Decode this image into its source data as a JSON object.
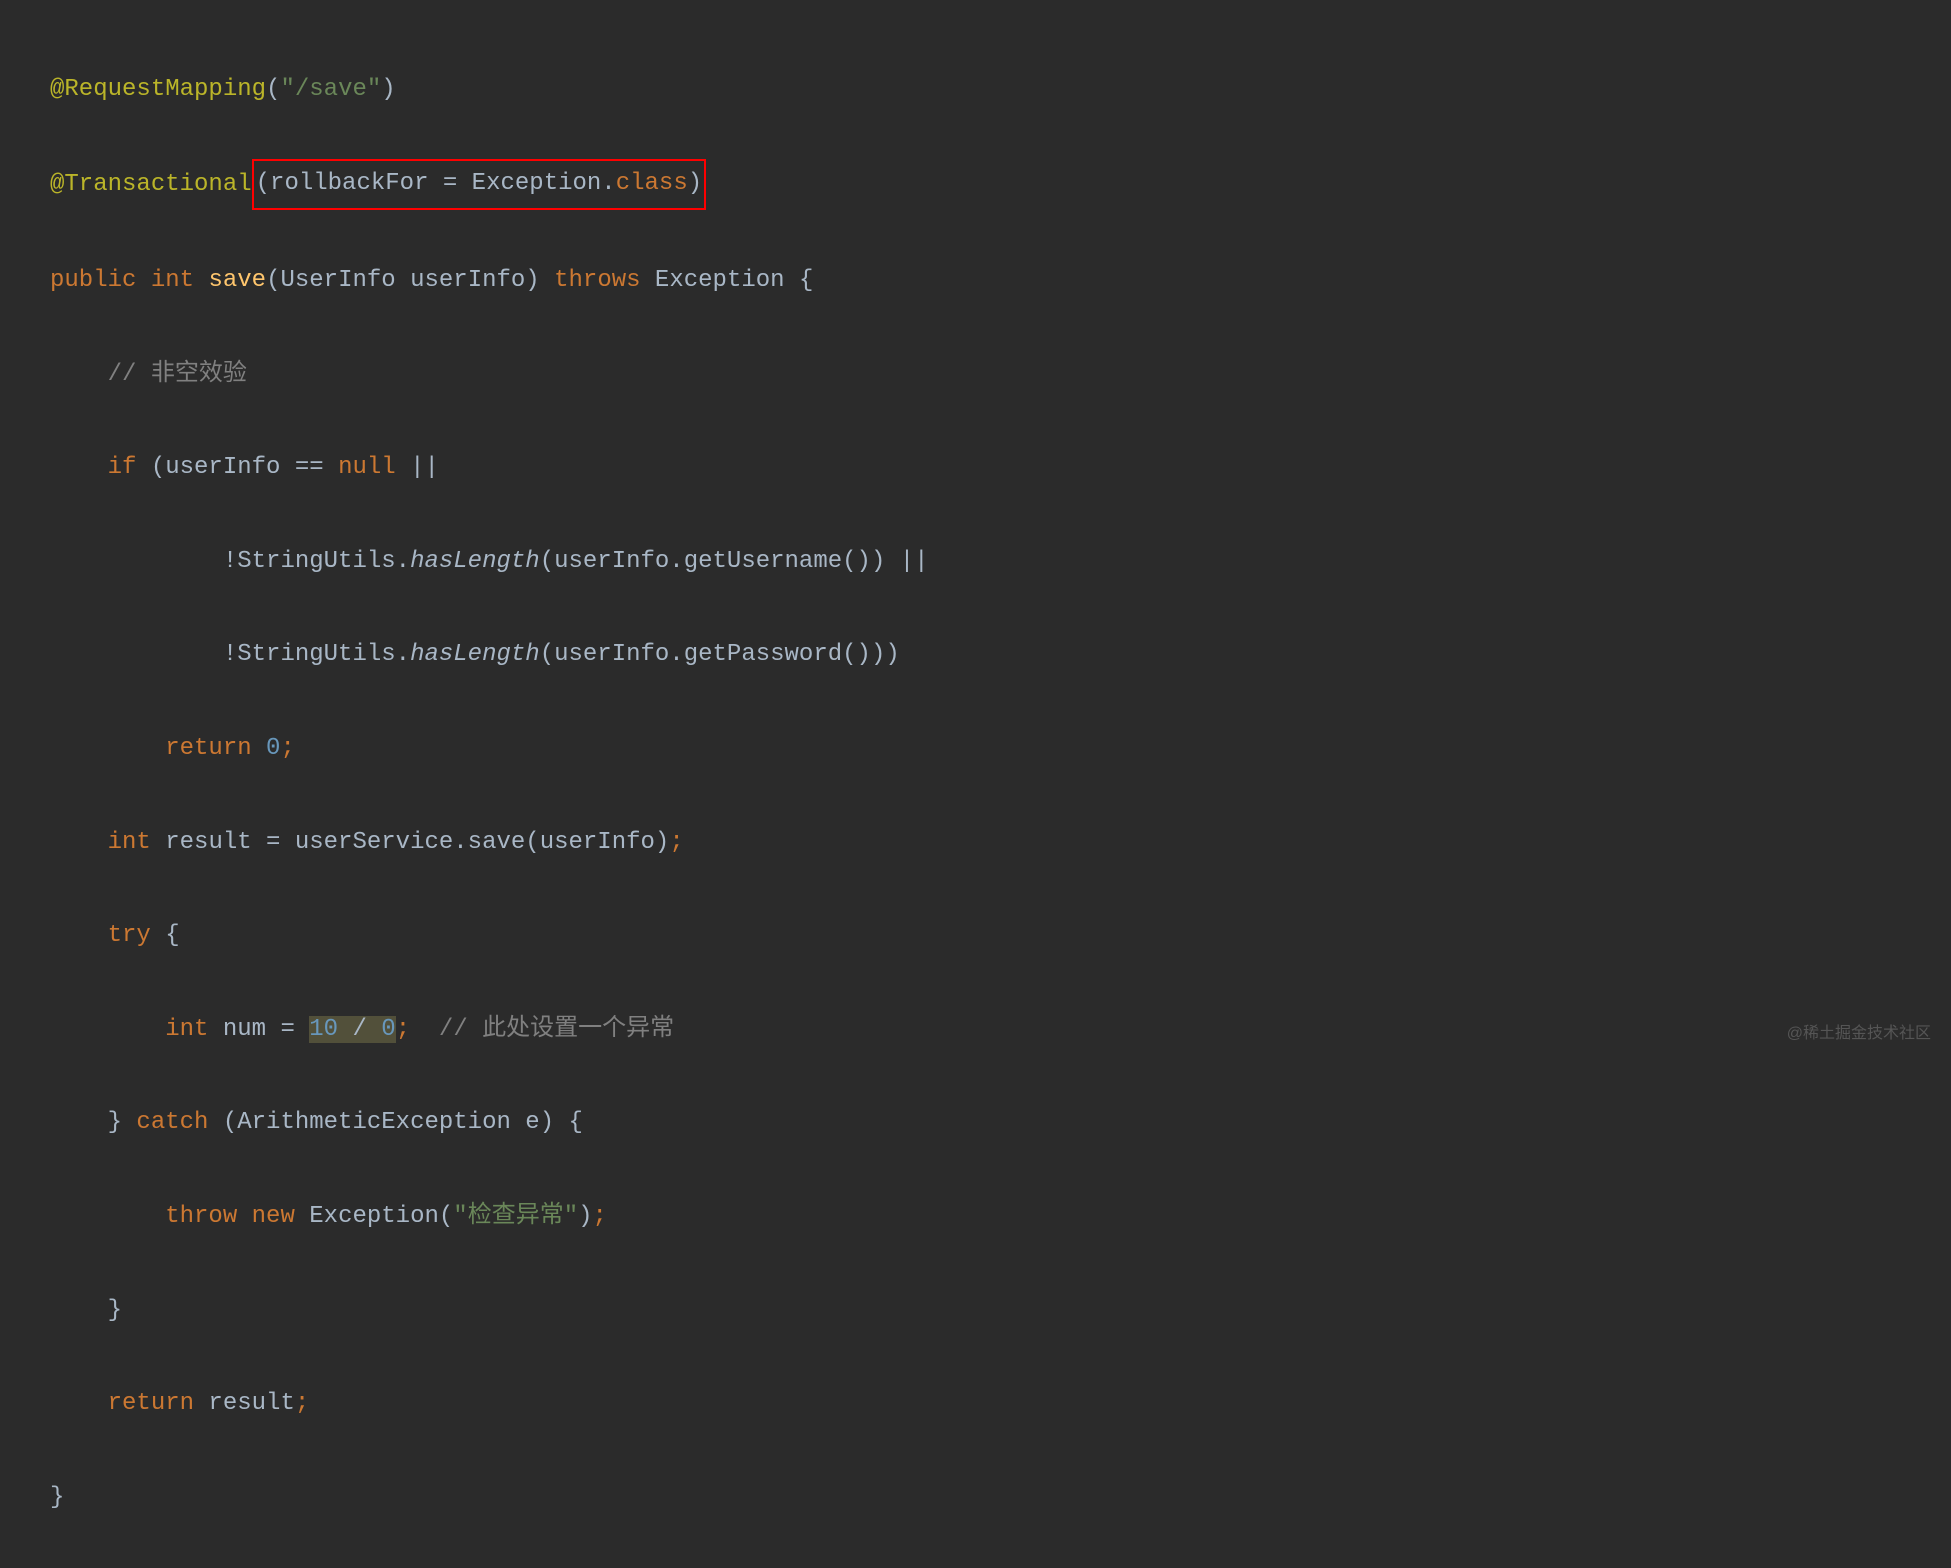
{
  "code": {
    "line1": {
      "annotation": "@RequestMapping",
      "paren_open": "(",
      "string": "\"/save\"",
      "paren_close": ")"
    },
    "line2": {
      "annotation": "@Transactional",
      "boxed_open": "(",
      "boxed_param": "rollbackFor = Exception.",
      "boxed_class": "class",
      "boxed_close": ")"
    },
    "line3": {
      "kw_public": "public",
      "kw_int": "int",
      "method_name": "save",
      "params": "(UserInfo userInfo) ",
      "kw_throws": "throws",
      "exception_cls": " Exception {"
    },
    "line4": {
      "comment": "// 非空效验"
    },
    "line5": {
      "kw_if": "if",
      "cond1": " (userInfo == ",
      "kw_null": "null",
      "cond1b": " ||"
    },
    "line6": {
      "neg": "!StringUtils.",
      "sm": "hasLength",
      "rest": "(userInfo.getUsername()) ||"
    },
    "line7": {
      "neg": "!StringUtils.",
      "sm": "hasLength",
      "rest": "(userInfo.getPassword()))"
    },
    "line8": {
      "kw_return": "return",
      "sp": " ",
      "num": "0",
      "semi": ";"
    },
    "line9": {
      "kw_int": "int",
      "rest1": " result = userService.save(userInfo)",
      "semi": ";"
    },
    "line10": {
      "kw_try": "try",
      "brace": " {"
    },
    "line11": {
      "kw_int": "int",
      "varname": " num = ",
      "n1": "10",
      "op": " / ",
      "n2": "0",
      "semi": ";",
      "sp": "  ",
      "comment": "// 此处设置一个异常"
    },
    "line12": {
      "rbrace": "} ",
      "kw_catch": "catch",
      "rest": " (ArithmeticException e) {"
    },
    "line13": {
      "kw_throw": "throw",
      "sp": " ",
      "kw_new": "new",
      "cls": " Exception(",
      "str": "\"检查异常\"",
      "close": ")",
      "semi": ";"
    },
    "line14": {
      "rbrace": "}"
    },
    "line15": {
      "kw_return": "return",
      "rest": " result",
      "semi": ";"
    },
    "line16": {
      "rbrace": "}"
    }
  },
  "watermark": "@稀土掘金技术社区"
}
